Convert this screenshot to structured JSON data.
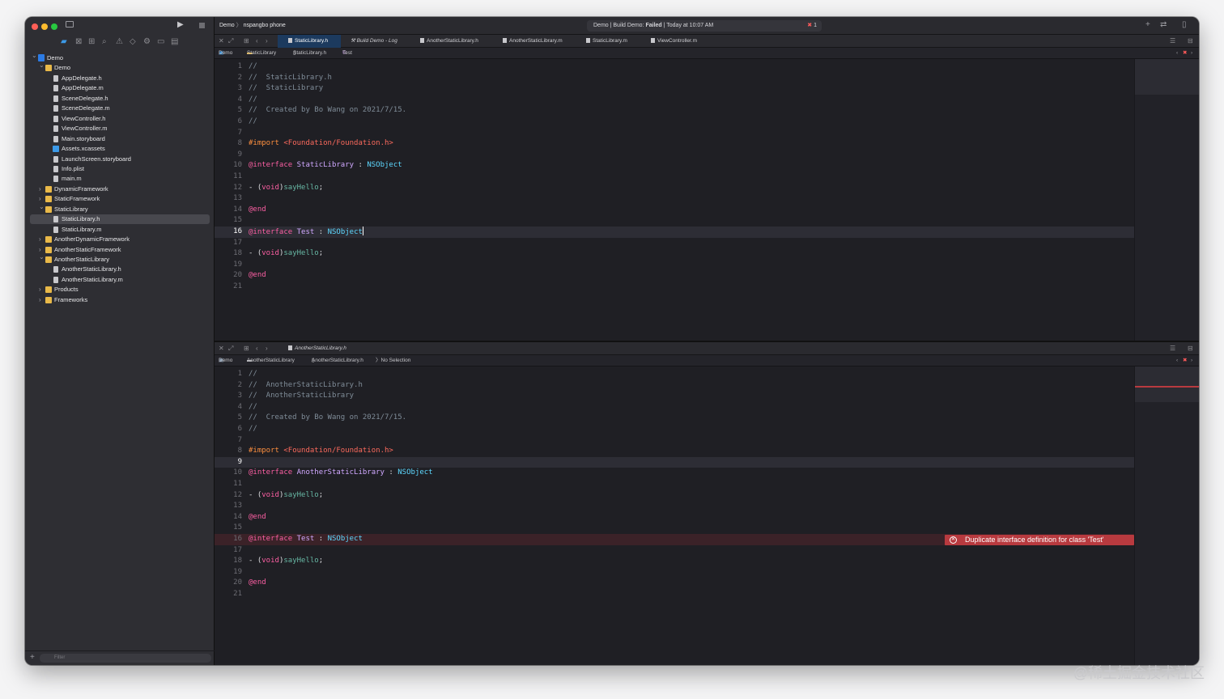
{
  "scheme": {
    "target": "Demo",
    "device": "nspangbo phone"
  },
  "status": {
    "prefix": "Demo | Build Demo: ",
    "state": "Failed",
    "suffix": " | Today at 10:07 AM",
    "error_count": "1"
  },
  "sidebar": {
    "filter_placeholder": "Filter",
    "items": [
      {
        "label": "Demo",
        "kind": "proj",
        "depth": 0,
        "open": true
      },
      {
        "label": "Demo",
        "kind": "folder",
        "depth": 1,
        "open": true
      },
      {
        "label": "AppDelegate.h",
        "kind": "file",
        "depth": 2
      },
      {
        "label": "AppDelegate.m",
        "kind": "file",
        "depth": 2
      },
      {
        "label": "SceneDelegate.h",
        "kind": "file",
        "depth": 2
      },
      {
        "label": "SceneDelegate.m",
        "kind": "file",
        "depth": 2
      },
      {
        "label": "ViewController.h",
        "kind": "file",
        "depth": 2
      },
      {
        "label": "ViewController.m",
        "kind": "file",
        "depth": 2
      },
      {
        "label": "Main.storyboard",
        "kind": "file",
        "depth": 2
      },
      {
        "label": "Assets.xcassets",
        "kind": "assets",
        "depth": 2
      },
      {
        "label": "LaunchScreen.storyboard",
        "kind": "file",
        "depth": 2
      },
      {
        "label": "Info.plist",
        "kind": "file",
        "depth": 2
      },
      {
        "label": "main.m",
        "kind": "file",
        "depth": 2
      },
      {
        "label": "DynamicFramework",
        "kind": "folder",
        "depth": 1,
        "open": false
      },
      {
        "label": "StaticFramework",
        "kind": "folder",
        "depth": 1,
        "open": false
      },
      {
        "label": "StaticLibrary",
        "kind": "folder",
        "depth": 1,
        "open": true
      },
      {
        "label": "StaticLibrary.h",
        "kind": "file",
        "depth": 2,
        "selected": true
      },
      {
        "label": "StaticLibrary.m",
        "kind": "file",
        "depth": 2
      },
      {
        "label": "AnotherDynamicFramework",
        "kind": "folder",
        "depth": 1,
        "open": false
      },
      {
        "label": "AnotherStaticFramework",
        "kind": "folder",
        "depth": 1,
        "open": false
      },
      {
        "label": "AnotherStaticLibrary",
        "kind": "folder",
        "depth": 1,
        "open": true
      },
      {
        "label": "AnotherStaticLibrary.h",
        "kind": "file",
        "depth": 2
      },
      {
        "label": "AnotherStaticLibrary.m",
        "kind": "file",
        "depth": 2
      },
      {
        "label": "Products",
        "kind": "folder",
        "depth": 1,
        "open": false
      },
      {
        "label": "Frameworks",
        "kind": "folder",
        "depth": 1,
        "open": false
      }
    ]
  },
  "top_pane": {
    "tabs": [
      "StaticLibrary.h",
      "Build Demo - Log",
      "AnotherStaticLibrary.h",
      "AnotherStaticLibrary.m",
      "StaticLibrary.m",
      "ViewController.m"
    ],
    "breadcrumb": [
      "Demo",
      "StaticLibrary",
      "StaticLibrary.h",
      "Test"
    ],
    "current_line": 16,
    "lines": [
      [
        [
          "c",
          "//"
        ]
      ],
      [
        [
          "c",
          "//  StaticLibrary.h"
        ]
      ],
      [
        [
          "c",
          "//  StaticLibrary"
        ]
      ],
      [
        [
          "c",
          "//"
        ]
      ],
      [
        [
          "c",
          "//  Created by Bo Wang on 2021/7/15."
        ]
      ],
      [
        [
          "c",
          "//"
        ]
      ],
      [],
      [
        [
          "pp",
          "#import "
        ],
        [
          "str",
          "<Foundation/Foundation.h>"
        ]
      ],
      [],
      [
        [
          "k",
          "@interface "
        ],
        [
          "ty",
          "StaticLibrary"
        ],
        [
          "p",
          " : "
        ],
        [
          "cls",
          "NSObject"
        ]
      ],
      [],
      [
        [
          "p",
          "- ("
        ],
        [
          "k",
          "void"
        ],
        [
          "p",
          ")"
        ],
        [
          "mn",
          "sayHello"
        ],
        [
          "p",
          ";"
        ]
      ],
      [],
      [
        [
          "k",
          "@end"
        ]
      ],
      [],
      [
        [
          "k",
          "@interface "
        ],
        [
          "ty",
          "Test"
        ],
        [
          "p",
          " : "
        ],
        [
          "cls",
          "NSObject"
        ],
        [
          "cursor",
          ""
        ]
      ],
      [],
      [
        [
          "p",
          "- ("
        ],
        [
          "k",
          "void"
        ],
        [
          "p",
          ")"
        ],
        [
          "mn",
          "sayHello"
        ],
        [
          "p",
          ";"
        ]
      ],
      [],
      [
        [
          "k",
          "@end"
        ]
      ],
      []
    ]
  },
  "bottom_pane": {
    "tabs": [
      "AnotherStaticLibrary.h"
    ],
    "breadcrumb": [
      "Demo",
      "AnotherStaticLibrary",
      "AnotherStaticLibrary.h",
      "No Selection"
    ],
    "current_line": 9,
    "error_line": 16,
    "error_message": "Duplicate interface definition for class 'Test'",
    "lines": [
      [
        [
          "c",
          "//"
        ]
      ],
      [
        [
          "c",
          "//  AnotherStaticLibrary.h"
        ]
      ],
      [
        [
          "c",
          "//  AnotherStaticLibrary"
        ]
      ],
      [
        [
          "c",
          "//"
        ]
      ],
      [
        [
          "c",
          "//  Created by Bo Wang on 2021/7/15."
        ]
      ],
      [
        [
          "c",
          "//"
        ]
      ],
      [],
      [
        [
          "pp",
          "#import "
        ],
        [
          "str",
          "<Foundation/Foundation.h>"
        ]
      ],
      [],
      [
        [
          "k",
          "@interface "
        ],
        [
          "ty",
          "AnotherStaticLibrary"
        ],
        [
          "p",
          " : "
        ],
        [
          "cls",
          "NSObject"
        ]
      ],
      [],
      [
        [
          "p",
          "- ("
        ],
        [
          "k",
          "void"
        ],
        [
          "p",
          ")"
        ],
        [
          "mn",
          "sayHello"
        ],
        [
          "p",
          ";"
        ]
      ],
      [],
      [
        [
          "k",
          "@end"
        ]
      ],
      [],
      [
        [
          "k",
          "@interface "
        ],
        [
          "ty",
          "Test"
        ],
        [
          "p",
          " : "
        ],
        [
          "cls",
          "NSObject"
        ]
      ],
      [],
      [
        [
          "p",
          "- ("
        ],
        [
          "k",
          "void"
        ],
        [
          "p",
          ")"
        ],
        [
          "mn",
          "sayHello"
        ],
        [
          "p",
          ";"
        ]
      ],
      [],
      [
        [
          "k",
          "@end"
        ]
      ],
      []
    ]
  },
  "watermark": "@稀土掘金技术社区"
}
